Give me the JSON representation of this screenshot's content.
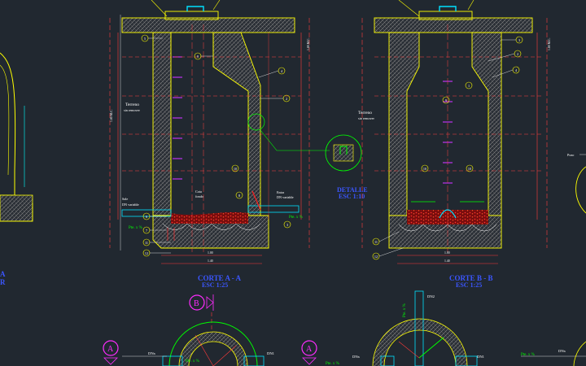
{
  "drawing": {
    "background": "#212830",
    "colors": {
      "outline": "#ffff00",
      "concrete": "#8a8a8a",
      "dimension": "#ff3b3b",
      "dashed": "#ff4040",
      "steps": "#cc33ff",
      "leader": "#00ff00",
      "caption": "#3b56ff",
      "sediment": "#e02020",
      "pipe": "#00e0ff",
      "label": "#ffffff"
    }
  },
  "section_a": {
    "caption": "CORTE A - A",
    "scale": "ESC 1:25",
    "labels": {
      "terreno": "Terreno",
      "sin_remover": "sin remover",
      "cota": "Cota",
      "fondo": "fondo",
      "sale": "Sale",
      "dn_variable": "DN variable",
      "entra": "Entra",
      "entra_dn": "DN variable",
      "slope_left": "Pte. x %",
      "slope_right": "Pte. x %",
      "height": "1.80 M.C.",
      "dim_inner": "1.00",
      "dim_outer": "1.40"
    },
    "callouts": [
      "1",
      "2",
      "3",
      "4",
      "5",
      "6",
      "7",
      "8",
      "9",
      "10",
      "11",
      "12"
    ]
  },
  "detail": {
    "caption": "DETALLE",
    "scale": "ESC 1:10"
  },
  "section_b": {
    "caption": "CORTE B - B",
    "scale": "ESC 1:25",
    "labels": {
      "terreno": "Terreno",
      "sin_remover": "sin remover",
      "height": "1.80 M.C.",
      "dim_inner": "1.00",
      "dim_outer": "1.40"
    },
    "callouts": [
      "1",
      "2",
      "3",
      "4",
      "9",
      "10",
      "11",
      "12"
    ]
  },
  "plan": {
    "marker_a": "A",
    "marker_b": "B",
    "dn1": "DN1",
    "dn2": "DN2",
    "dn_left": "DNx",
    "dn_right": "DN1",
    "dn_far": "DNx",
    "slope1": "Pte. x %",
    "slope2": "Pte. x %",
    "slope3": "Pte. x %",
    "slope4": "Pte. x %"
  },
  "left_fragment": {
    "caption_line1": "A",
    "caption_line2": "R"
  },
  "right_fragment": {
    "label": "Pozo"
  }
}
